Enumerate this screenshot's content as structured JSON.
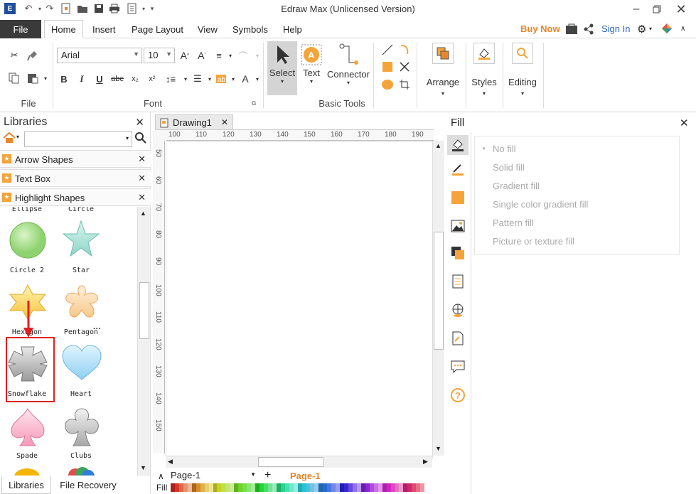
{
  "app": {
    "title": "Edraw Max (Unlicensed Version)"
  },
  "menu": {
    "file": "File",
    "tabs": [
      "Home",
      "Insert",
      "Page Layout",
      "View",
      "Symbols",
      "Help"
    ],
    "buy_now": "Buy Now",
    "sign_in": "Sign In"
  },
  "ribbon": {
    "groups": {
      "file": "File",
      "font": "Font",
      "basic_tools": "Basic Tools"
    },
    "font_name": "Arial",
    "font_size": "10",
    "tools": {
      "select": "Select",
      "text": "Text",
      "connector": "Connector",
      "arrange": "Arrange",
      "styles": "Styles",
      "editing": "Editing"
    }
  },
  "libraries": {
    "title": "Libraries",
    "categories": [
      "Arrow Shapes",
      "Text Box",
      "Highlight Shapes"
    ],
    "shapes": [
      {
        "name": "Ellipse"
      },
      {
        "name": "Circle"
      },
      {
        "name": "Circle 2"
      },
      {
        "name": "Star"
      },
      {
        "name": "Hexagon"
      },
      {
        "name": "Pentagon"
      },
      {
        "name": "Snowflake"
      },
      {
        "name": "Heart"
      },
      {
        "name": "Spade"
      },
      {
        "name": "Clubs"
      }
    ],
    "bottom_tabs": [
      "Libraries",
      "File Recovery"
    ]
  },
  "document": {
    "tab": "Drawing1",
    "ruler_h": [
      "100",
      "110",
      "120",
      "130",
      "140",
      "150",
      "160",
      "170",
      "180",
      "190"
    ],
    "ruler_v": [
      "50",
      "60",
      "70",
      "80",
      "90",
      "100",
      "110",
      "120",
      "130",
      "140",
      "150"
    ],
    "page_selector": "Page-1",
    "active_page": "Page-1",
    "fill_label": "Fill"
  },
  "fill_panel": {
    "title": "Fill",
    "options": [
      "No fill",
      "Solid fill",
      "Gradient fill",
      "Single color gradient fill",
      "Pattern fill",
      "Picture or texture fill"
    ]
  },
  "colors": {
    "accent": "#f5a43a",
    "highlight_border": "#e02020",
    "file_tab": "#3a3a3a",
    "buy_now": "#e8862b",
    "sign_in": "#2a67c5"
  }
}
